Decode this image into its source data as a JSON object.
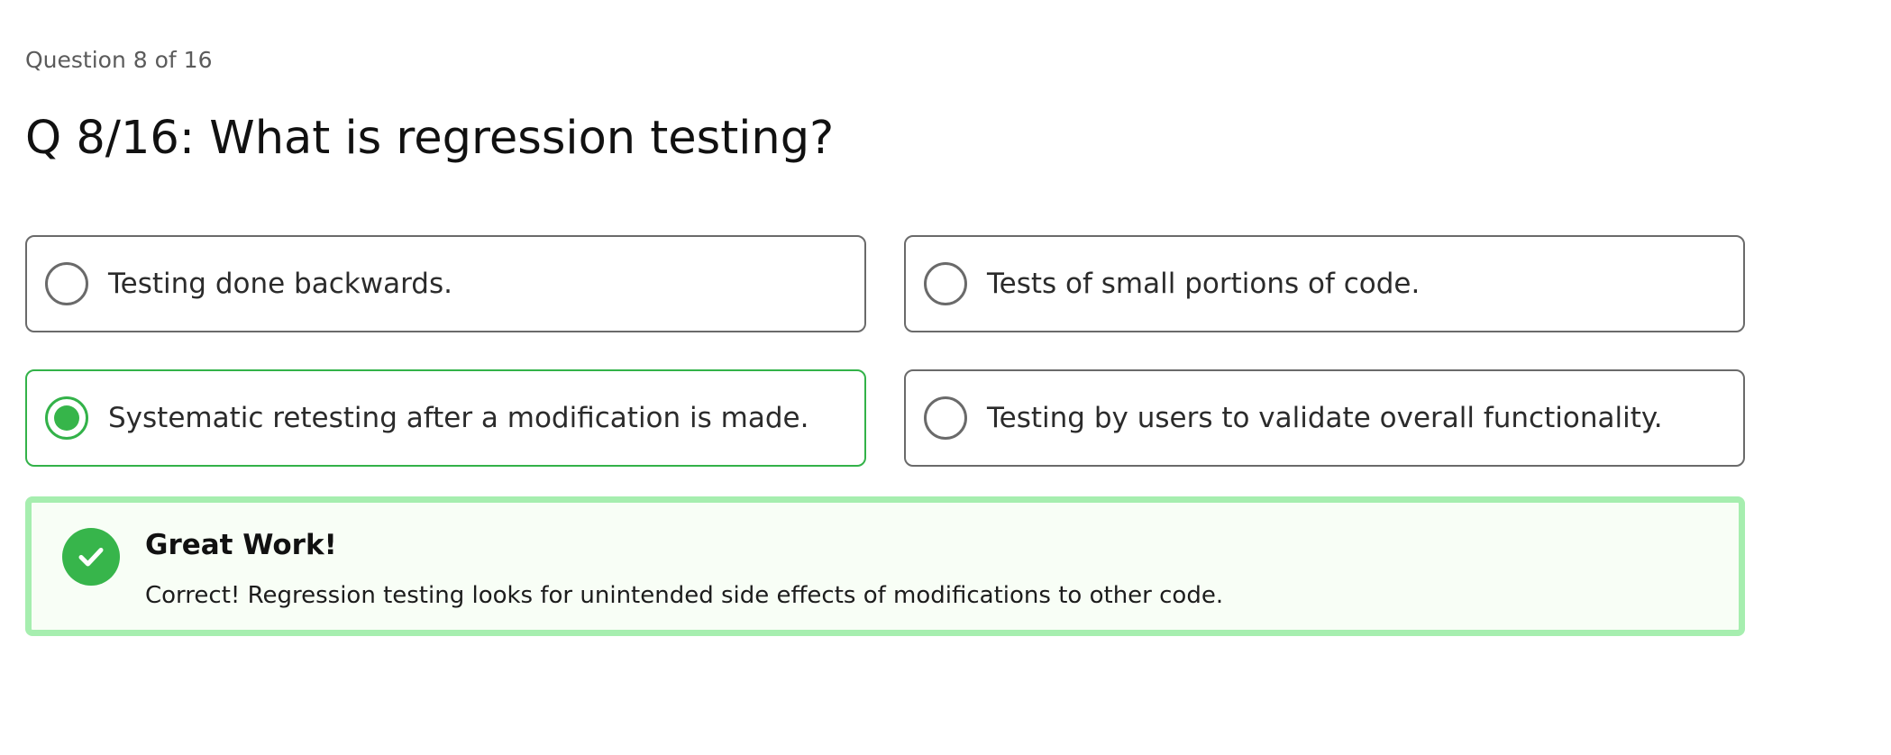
{
  "quiz": {
    "progress_label": "Question 8 of 16",
    "question_text": "Q 8/16: What is regression testing?",
    "options": [
      {
        "label": "Testing done backwards.",
        "selected": false
      },
      {
        "label": "Tests of small portions of code.",
        "selected": false
      },
      {
        "label": "Systematic retesting after a modification is made.",
        "selected": true
      },
      {
        "label": "Testing by users to validate overall functionality.",
        "selected": false
      }
    ],
    "feedback": {
      "status": "correct",
      "icon": "checkmark-icon",
      "title": "Great Work!",
      "message": "Correct! Regression testing looks for unintended side effects of modifications to other code."
    }
  },
  "colors": {
    "accent_green": "#36b54a",
    "feedback_border": "#a6eeaf",
    "feedback_background": "#f8fef6",
    "option_border": "#6a6a6a"
  }
}
